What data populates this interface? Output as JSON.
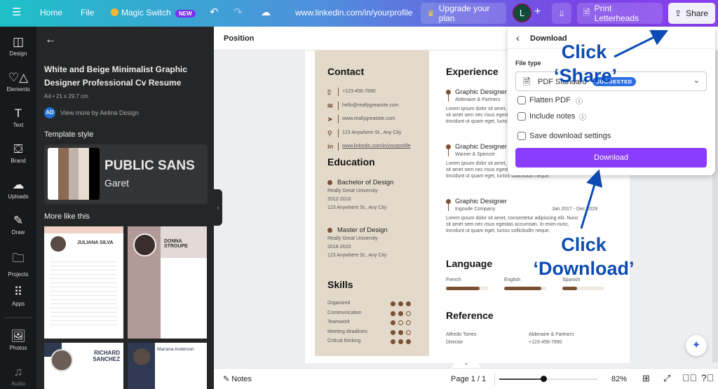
{
  "topbar": {
    "menu_icon": "hamburger-icon",
    "home": "Home",
    "file": "File",
    "magic_switch": "Magic Switch",
    "new_badge": "NEW",
    "undo_icon": "undo-icon",
    "redo_icon": "redo-icon",
    "cloud_icon": "cloud-saved-icon",
    "doc_title": "www.linkedin.com/in/yourprofile",
    "upgrade": "Upgrade your plan",
    "avatar_initial": "L",
    "add_icon": "plus-icon",
    "analytics_icon": "bar-chart-icon",
    "print": "Print Letterheads",
    "share": "Share",
    "colors": {
      "gradient_start": "#1ec0c8",
      "gradient_end": "#8a3ff0",
      "avatar": "#0f4d3a"
    }
  },
  "rail": {
    "items": [
      {
        "label": "Design",
        "icon": "layout-icon"
      },
      {
        "label": "Elements",
        "icon": "shapes-icon"
      },
      {
        "label": "Text",
        "icon": "text-icon"
      },
      {
        "label": "Brand",
        "icon": "brand-icon"
      },
      {
        "label": "Uploads",
        "icon": "cloud-upload-icon"
      },
      {
        "label": "Draw",
        "icon": "pen-icon"
      },
      {
        "label": "Projects",
        "icon": "folder-icon"
      },
      {
        "label": "Apps",
        "icon": "grid-icon"
      },
      {
        "label": "Photos",
        "icon": "image-icon"
      },
      {
        "label": "Audio",
        "icon": "music-icon"
      }
    ]
  },
  "panel": {
    "title": "White and Beige Minimalist Graphic Designer Professional Cv Resume",
    "meta": "A4 • 21 x 29.7 cm",
    "author_initials": "AD",
    "author_link": "View more by Aelina Design",
    "template_style": "Template style",
    "swatches": [
      "#ffffff",
      "#8a6a52",
      "#bdb3aa",
      "#e6ddd0",
      "#000000"
    ],
    "font_primary": "PUBLIC SANS",
    "font_secondary": "Garet",
    "more_like_this": "More like this",
    "thumbs": [
      {
        "name": "JULIANA SILVA"
      },
      {
        "name": "DONNA STROUPE"
      },
      {
        "name": "RICHARD SANCHEZ"
      },
      {
        "name": "Mariana Anderson"
      }
    ]
  },
  "canvas": {
    "position": "Position"
  },
  "resume": {
    "contact_title": "Contact",
    "contacts": [
      {
        "icon": "phone-icon",
        "text": "+123-456-7890"
      },
      {
        "icon": "mail-icon",
        "text": "hello@reallygreatsite.com"
      },
      {
        "icon": "cursor-icon",
        "text": "www.reallygreatsite.com"
      },
      {
        "icon": "location-icon",
        "text": "123 Anywhere  St., Any City"
      },
      {
        "icon": "linkedin-icon",
        "text": "www.linkedin.com/in/yourprofile"
      }
    ],
    "education_title": "Education",
    "education": [
      {
        "degree": "Bachelor of Design",
        "school": "Really Great University",
        "years": "2012-2016",
        "addr": "123 Anywhere St., Any City"
      },
      {
        "degree": "Master of Design",
        "school": "Really Great University",
        "years": "2016-2020",
        "addr": "123 Anywhere St., Any City"
      }
    ],
    "skills_title": "Skills",
    "skills": [
      {
        "name": "Organized",
        "level": 3
      },
      {
        "name": "Communication",
        "level": 2
      },
      {
        "name": "Teamwork",
        "level": 1
      },
      {
        "name": "Meeting deadlines",
        "level": 2
      },
      {
        "name": "Critical thinking",
        "level": 3
      }
    ],
    "experience_title": "Experience",
    "experience": [
      {
        "role": "Graphic Designer",
        "company": "Aldenaire & Partners",
        "dates": "",
        "l1": "Lorem ipsum dolor sit amet, consectetur adipiscing elit. Nunc",
        "l2": "sit amet sem nec risus egestas accumsan. In enim nunc,",
        "l3": "tincidunt ut quam eget, luctus sollicitudin neque."
      },
      {
        "role": "Graphic Designer",
        "company": "Warner & Spencer",
        "dates": "",
        "l1": "Lorem ipsum dolor sit amet, consectetur adipiscing elit. Nunc",
        "l2": "sit amet sem nec risus egestas accumsan. In enim nunc,",
        "l3": "tincidunt ut quam eget, luctus sollicitudin neque."
      },
      {
        "role": "Graphic Designer",
        "company": "Ingoude Company",
        "dates": "Jan 2017 - Dec 2029",
        "l1": "Lorem ipsum dolor sit amet, consectetur adipiscing elit. Nunc",
        "l2": "sit amet sem nec risus egestas accumsan. In enim nunc,",
        "l3": "tincidunt ut quam eget, luctus sollicitudin neque."
      }
    ],
    "language_title": "Language",
    "languages": [
      {
        "name": "French",
        "level": 0.8
      },
      {
        "name": "English",
        "level": 0.88
      },
      {
        "name": "Spanish",
        "level": 0.35
      }
    ],
    "reference_title": "Reference",
    "references": [
      {
        "name": "Alfredo Torres",
        "title": "Director"
      },
      {
        "name": "Aldenaire & Partners",
        "title": "+123-456-7890"
      }
    ],
    "colors": {
      "sidebar": "#e4dacb",
      "accent": "#7a5134"
    }
  },
  "dialog": {
    "title": "Download",
    "file_type_label": "File type",
    "file_type": "PDF Standard",
    "suggested": "SUGGESTED",
    "flatten": "Flatten PDF",
    "include_notes": "Include notes",
    "save_settings": "Save download settings",
    "download": "Download",
    "colors": {
      "button": "#8b3dff"
    }
  },
  "annotations": {
    "share": "Click\n‘Share’",
    "share_l1": "Click",
    "share_l2": "‘Share’",
    "download_l1": "Click",
    "download_l2": "‘Download’",
    "color": "#0b4bb3"
  },
  "bottom": {
    "notes": "Notes",
    "page": "Page 1 / 1",
    "zoom": "82%",
    "zoom_value": 82
  }
}
